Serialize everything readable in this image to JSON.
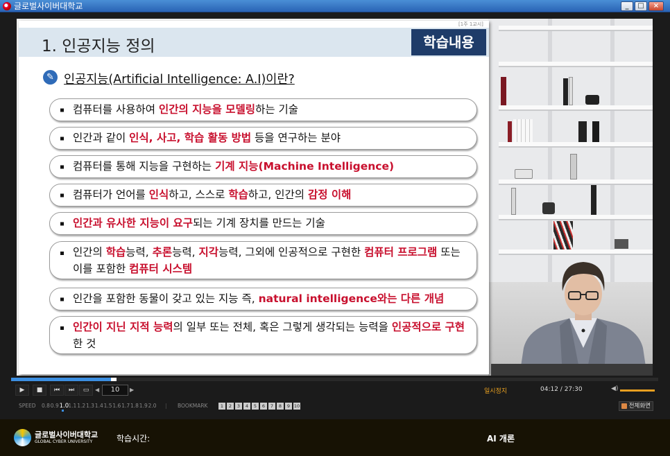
{
  "window": {
    "title": "글로벌사이버대학교",
    "minimize": "_",
    "maximize": "□",
    "close": "×"
  },
  "slide": {
    "lesson_tag": "[1주 1교시]",
    "title": "1. 인공지능 정의",
    "badge": "학습내용",
    "question": "인공지능(Artificial Intelligence: A.I)이란?",
    "items": [
      {
        "segments": [
          {
            "t": "컴퓨터를 사용하여 ",
            "r": false
          },
          {
            "t": "인간의 지능을 모델링",
            "r": true
          },
          {
            "t": "하는 기술",
            "r": false
          }
        ]
      },
      {
        "segments": [
          {
            "t": "인간과 같이 ",
            "r": false
          },
          {
            "t": "인식, 사고, 학습 활동 방법",
            "r": true
          },
          {
            "t": " 등을 연구하는 분야",
            "r": false
          }
        ]
      },
      {
        "segments": [
          {
            "t": "컴퓨터를 통해 지능을 구현하는 ",
            "r": false
          },
          {
            "t": "기계 지능(Machine Intelligence)",
            "r": true
          }
        ]
      },
      {
        "segments": [
          {
            "t": "컴퓨터가 언어를 ",
            "r": false
          },
          {
            "t": "인식",
            "r": true
          },
          {
            "t": "하고, 스스로 ",
            "r": false
          },
          {
            "t": "학습",
            "r": true
          },
          {
            "t": "하고, 인간의 ",
            "r": false
          },
          {
            "t": "감정 이해",
            "r": true
          }
        ]
      },
      {
        "segments": [
          {
            "t": "인간과 유사한 지능이 요구",
            "r": true
          },
          {
            "t": "되는 기계 장치를 만드는 기술",
            "r": false
          }
        ]
      },
      {
        "segments": [
          {
            "t": "인간의 ",
            "r": false
          },
          {
            "t": "학습",
            "r": true
          },
          {
            "t": "능력, ",
            "r": false
          },
          {
            "t": "추론",
            "r": true
          },
          {
            "t": "능력, ",
            "r": false
          },
          {
            "t": "지각",
            "r": true
          },
          {
            "t": "능력, 그외에 인공적으로 구현한 ",
            "r": false
          },
          {
            "t": "컴퓨터 프로그램",
            "r": true
          },
          {
            "t": " 또는 이를 포함한 ",
            "r": false
          },
          {
            "t": "컴퓨터 시스템",
            "r": true
          }
        ]
      },
      {
        "segments": [
          {
            "t": "인간을 포함한 동물이 갖고 있는 지능 즉, ",
            "r": false
          },
          {
            "t": "natural intelligence와는 다른 개념",
            "r": true
          }
        ]
      },
      {
        "segments": [
          {
            "t": "인간이 지닌 지적 능력",
            "r": true
          },
          {
            "t": "의 일부 또는 전체, 혹은 그렇게 생각되는 능력을 ",
            "r": false
          },
          {
            "t": "인공적으로 구현",
            "r": true
          },
          {
            "t": "한 것",
            "r": false
          }
        ]
      }
    ]
  },
  "player": {
    "progress_fraction": 0.154,
    "page": "10",
    "status": "일시정지",
    "time": "04:12 / 27:30",
    "volume_fraction": 1.0,
    "speed_label": "SPEED",
    "speeds": [
      "0.8",
      "0.9",
      "1.0",
      "1.1",
      "1.2",
      "1.3",
      "1.4",
      "1.5",
      "1.6",
      "1.7",
      "1.8",
      "1.9",
      "2.0"
    ],
    "speed_selected": "1.0",
    "bookmark_label": "BOOKMARK",
    "bookmarks": [
      "1",
      "2",
      "3",
      "4",
      "5",
      "6",
      "7",
      "8",
      "9",
      "10"
    ],
    "fullscreen_label": "전체화면"
  },
  "footer": {
    "university": "글로벌사이버대학교",
    "university_en": "GLOBAL CYBER UNIVERSITY",
    "study_time_label": "학습시간:",
    "course_title": "AI 개론"
  },
  "colors": {
    "accent_red": "#c8102e",
    "badge_navy": "#1f3c69",
    "progress_blue": "#3c8ee0",
    "status_orange": "#e8a020"
  }
}
